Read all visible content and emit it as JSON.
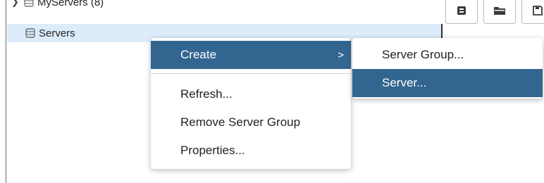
{
  "tree": {
    "parent_label": "MyServers (8)",
    "selected_label": "Servers"
  },
  "toolbar": {
    "buttons": [
      "database-icon",
      "folder-icon",
      "save-icon"
    ]
  },
  "context_menu": {
    "items": {
      "create": "Create",
      "refresh": "Refresh...",
      "remove": "Remove Server Group",
      "properties": "Properties..."
    },
    "submenu_arrow": ">"
  },
  "submenu": {
    "items": {
      "server_group": "Server Group...",
      "server": "Server..."
    }
  },
  "colors": {
    "menu_highlight": "#326690",
    "tree_selection": "#dcecfb"
  }
}
